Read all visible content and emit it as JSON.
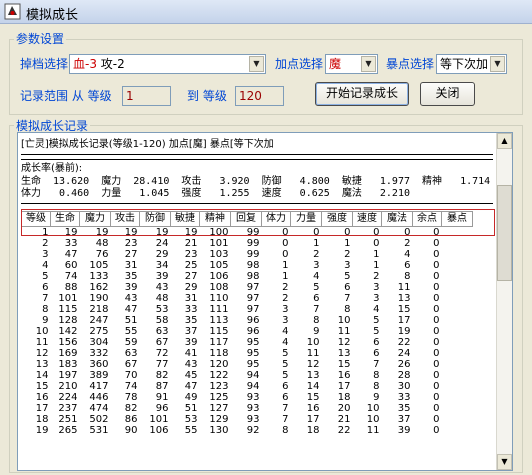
{
  "window": {
    "title": "模拟成长"
  },
  "params": {
    "group_label": "参数设置",
    "drop_label": "掉档选择",
    "drop_value_red": "血-3",
    "drop_value_rest": " 攻-2",
    "point_label": "加点选择",
    "point_value": "魔",
    "crit_label": "暴点选择",
    "crit_value": "等下次加",
    "range_label": "记录范围 从 等级",
    "from_level": "1",
    "to_label": "到 等级",
    "to_level": "120",
    "start_button": "开始记录成长",
    "close_button": "关闭"
  },
  "record": {
    "group_label": "模拟成长记录",
    "header_line": "[亡灵]模拟成长记录(等级1-120) 加点[魔] 暴点[等下次加",
    "growth_title": "成长率(暴前):",
    "growth_line1": "生命  13.620  魔力  28.410  攻击   3.920  防御   4.800  敏捷   1.977  精神   1.714",
    "growth_line2": "体力   0.460  力量   1.045  强度   1.255  速度   0.625  魔法   2.210",
    "columns": [
      "等级",
      "生命",
      "魔力",
      "攻击",
      "防御",
      "敏捷",
      "精神",
      "回复",
      "体力",
      "力量",
      "强度",
      "速度",
      "魔法",
      "余点",
      "暴点"
    ],
    "rows": [
      [
        "1",
        "19",
        "19",
        "19",
        "19",
        "19",
        "100",
        "99",
        "0",
        "0",
        "0",
        "0",
        "0",
        "0",
        ""
      ],
      [
        "2",
        "33",
        "48",
        "23",
        "24",
        "21",
        "101",
        "99",
        "0",
        "1",
        "1",
        "0",
        "2",
        "0",
        ""
      ],
      [
        "3",
        "47",
        "76",
        "27",
        "29",
        "23",
        "103",
        "99",
        "0",
        "2",
        "2",
        "1",
        "4",
        "0",
        ""
      ],
      [
        "4",
        "60",
        "105",
        "31",
        "34",
        "25",
        "105",
        "98",
        "1",
        "3",
        "3",
        "1",
        "6",
        "0",
        ""
      ],
      [
        "5",
        "74",
        "133",
        "35",
        "39",
        "27",
        "106",
        "98",
        "1",
        "4",
        "5",
        "2",
        "8",
        "0",
        ""
      ],
      [
        "6",
        "88",
        "162",
        "39",
        "43",
        "29",
        "108",
        "97",
        "2",
        "5",
        "6",
        "3",
        "11",
        "0",
        ""
      ],
      [
        "7",
        "101",
        "190",
        "43",
        "48",
        "31",
        "110",
        "97",
        "2",
        "6",
        "7",
        "3",
        "13",
        "0",
        ""
      ],
      [
        "8",
        "115",
        "218",
        "47",
        "53",
        "33",
        "111",
        "97",
        "3",
        "7",
        "8",
        "4",
        "15",
        "0",
        ""
      ],
      [
        "9",
        "128",
        "247",
        "51",
        "58",
        "35",
        "113",
        "96",
        "3",
        "8",
        "10",
        "5",
        "17",
        "0",
        ""
      ],
      [
        "10",
        "142",
        "275",
        "55",
        "63",
        "37",
        "115",
        "96",
        "4",
        "9",
        "11",
        "5",
        "19",
        "0",
        ""
      ],
      [
        "11",
        "156",
        "304",
        "59",
        "67",
        "39",
        "117",
        "95",
        "4",
        "10",
        "12",
        "6",
        "22",
        "0",
        ""
      ],
      [
        "12",
        "169",
        "332",
        "63",
        "72",
        "41",
        "118",
        "95",
        "5",
        "11",
        "13",
        "6",
        "24",
        "0",
        ""
      ],
      [
        "13",
        "183",
        "360",
        "67",
        "77",
        "43",
        "120",
        "95",
        "5",
        "12",
        "15",
        "7",
        "26",
        "0",
        ""
      ],
      [
        "14",
        "197",
        "389",
        "70",
        "82",
        "45",
        "122",
        "94",
        "5",
        "13",
        "16",
        "8",
        "28",
        "0",
        ""
      ],
      [
        "15",
        "210",
        "417",
        "74",
        "87",
        "47",
        "123",
        "94",
        "6",
        "14",
        "17",
        "8",
        "30",
        "0",
        ""
      ],
      [
        "16",
        "224",
        "446",
        "78",
        "91",
        "49",
        "125",
        "93",
        "6",
        "15",
        "18",
        "9",
        "33",
        "0",
        ""
      ],
      [
        "17",
        "237",
        "474",
        "82",
        "96",
        "51",
        "127",
        "93",
        "7",
        "16",
        "20",
        "10",
        "35",
        "0",
        ""
      ],
      [
        "18",
        "251",
        "502",
        "86",
        "101",
        "53",
        "129",
        "93",
        "7",
        "17",
        "21",
        "10",
        "37",
        "0",
        ""
      ],
      [
        "19",
        "265",
        "531",
        "90",
        "106",
        "55",
        "130",
        "92",
        "8",
        "18",
        "22",
        "11",
        "39",
        "0",
        ""
      ]
    ]
  }
}
